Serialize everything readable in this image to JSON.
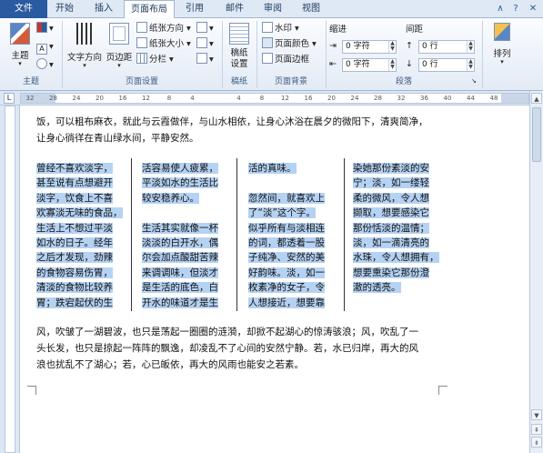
{
  "tabs": [
    "文件",
    "开始",
    "插入",
    "页面布局",
    "引用",
    "邮件",
    "审阅",
    "视图"
  ],
  "ribbon": {
    "groups": {
      "page_setup": "页面设置",
      "manuscript": "稿纸",
      "background": "页面背景",
      "paragraph": "段落",
      "theme": "主题"
    },
    "theme_btn": "主题",
    "text_direction": "文字方向",
    "margins": "页边距",
    "orientation": "纸张方向",
    "size": "纸张大小",
    "columns": "分栏",
    "manuscript_settings_line1": "稿纸",
    "manuscript_settings_line2": "设置",
    "watermark": "水印",
    "page_color": "页面颜色",
    "page_border": "页面边框",
    "indent_title": "缩进",
    "spacing_title": "间距",
    "indent_left": "0 字符",
    "indent_right": "0 字符",
    "spacing_before": "0 行",
    "spacing_after": "0 行",
    "arrange": "排列"
  },
  "ruler_numbers": [
    "32",
    "28",
    "24",
    "20",
    "16",
    "12",
    "8",
    "4",
    "",
    "4",
    "8",
    "12",
    "16",
    "20",
    "24",
    "28",
    "32",
    "36",
    "40",
    "44",
    "48"
  ],
  "document": {
    "intro_lines": [
      "饭，可以粗布麻衣，就此与云霞做伴，与山水相依，让身心沐浴在晨夕的微阳下，清爽简净，",
      "让身心徜徉在青山绿水间，平静安然。"
    ],
    "columns": [
      [
        "曾经不喜欢淡字，",
        "甚至说有点想避开",
        "淡字，饮食上不喜",
        "欢寡淡无味的食品，",
        "生活上不想过平淡",
        "如水的日子。经年",
        "之后才发现，劲辣",
        "的食物容易伤胃，",
        "清淡的食物比较养",
        "胃；跌宕起伏的生"
      ],
      [
        "活容易使人疲累，",
        "平淡如水的生活比",
        "较安稳养心。",
        "",
        "生活其实就像一杯",
        "淡淡的白开水，偶",
        "尔会加点酸甜苦辣",
        "来调调味，但淡才",
        "是生活的底色，白",
        "开水的味道才是生"
      ],
      [
        "活的真味。",
        "",
        "忽然间，就喜欢上",
        "了“淡”这个字。",
        "似乎所有与淡相连",
        "的词，都透着一股",
        "子纯净、安然的美",
        "好韵味。淡，如一",
        "枚素净的女子，令",
        "人想接近，想要靠"
      ],
      [
        "染她那份素淡的安",
        "宁；淡，如一缕轻",
        "柔的微风，令人想",
        "撷取，想要感染它",
        "那份恬淡的温情；",
        "淡，如一滴清亮的",
        "水珠，令人想拥有，",
        "想要熏染它那份澄",
        "澈的透亮。"
      ]
    ],
    "outro_lines": [
      "风，吹皱了一湖碧波，也只是荡起一圈圈的涟漪，却掀不起湖心的惊涛骇浪；风，吹乱了一",
      "头长发，也只是掠起一阵阵的飘逸，却凌乱不了心间的安然宁静。若，水已归岸，再大的风",
      "浪也扰乱不了湖心；若，心已皈依，再大的风雨也能安之若素。"
    ]
  }
}
